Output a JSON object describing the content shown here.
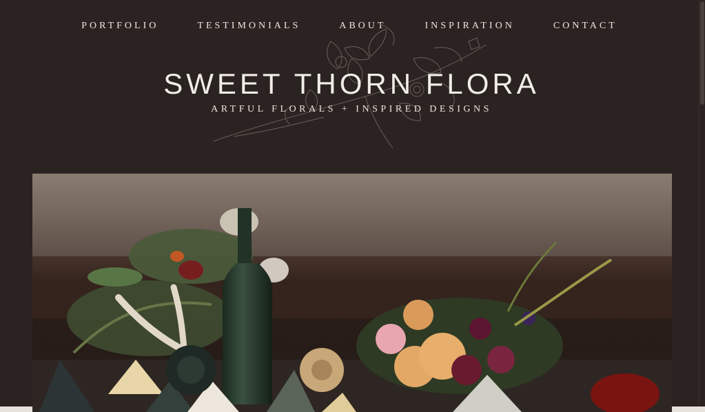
{
  "nav": {
    "items": [
      {
        "label": "PORTFOLIO"
      },
      {
        "label": "TESTIMONIALS"
      },
      {
        "label": "ABOUT"
      },
      {
        "label": "INSPIRATION"
      },
      {
        "label": "CONTACT"
      }
    ]
  },
  "brand": {
    "title": "SWEET THORN FLORA",
    "tagline": "ARTFUL FLORALS + INSPIRED DESIGNS"
  },
  "hero": {
    "image_icon": "floral-tablescape-photo"
  },
  "colors": {
    "background": "#2a2321",
    "text": "#ede7e0"
  }
}
